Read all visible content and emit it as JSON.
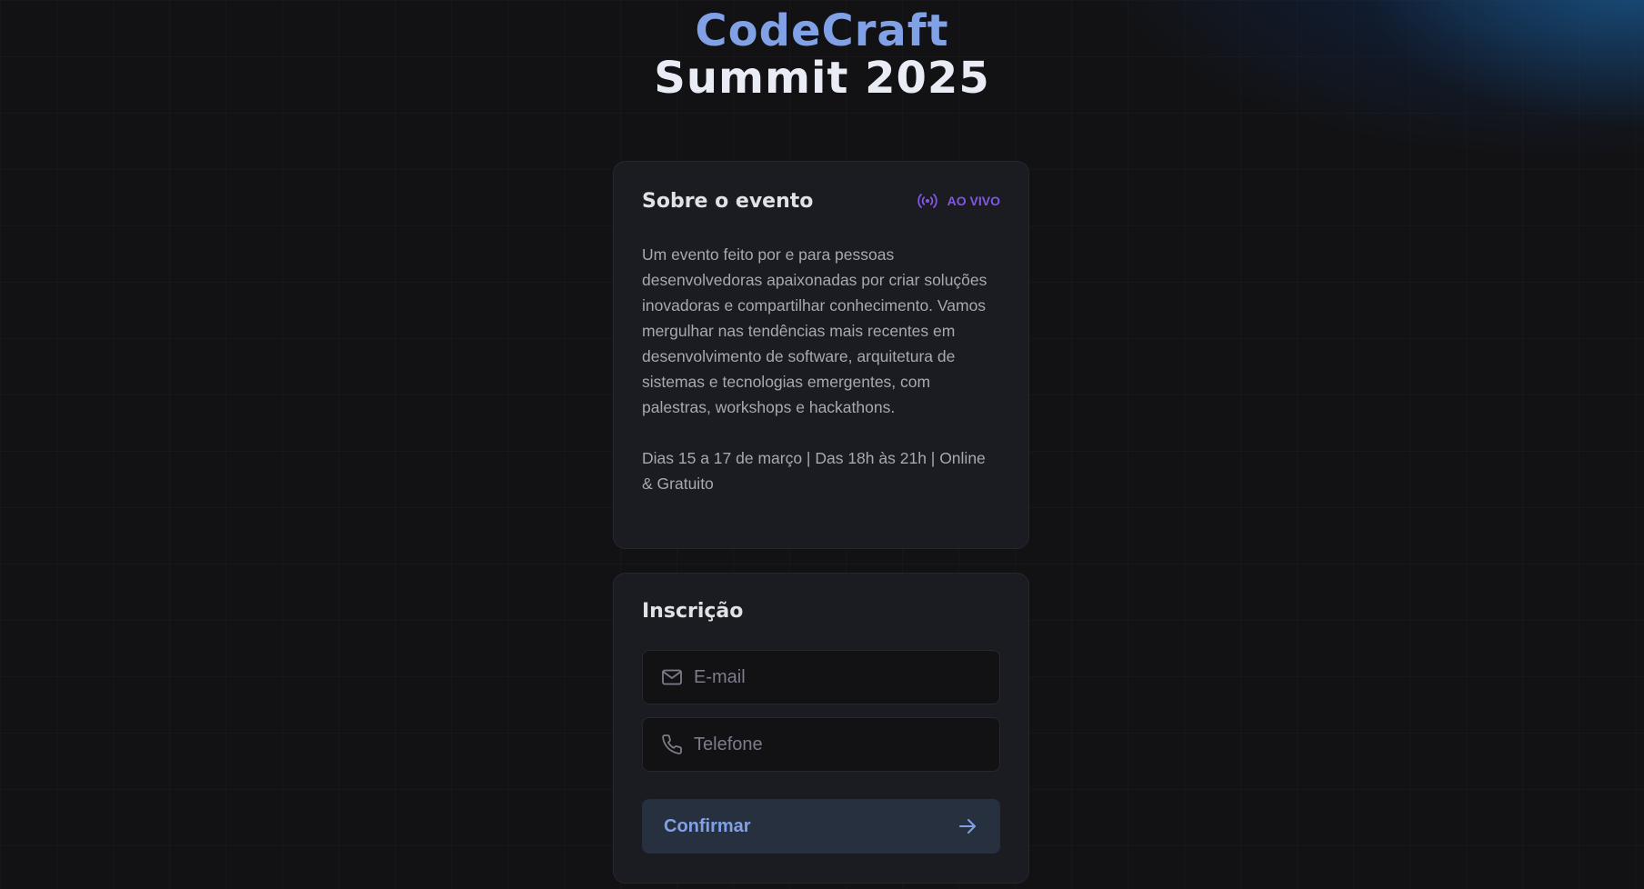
{
  "logo": {
    "line1": "CodeCraft",
    "line2": "Summit 2025"
  },
  "about": {
    "title": "Sobre o evento",
    "badge_icon": "radio-broadcast-icon",
    "badge_label": "AO VIVO",
    "description": "Um evento feito por e para pessoas desenvolvedoras apaixonadas por criar soluções inovadoras e compartilhar conhecimento. Vamos mergulhar nas tendências mais recentes em desenvolvimento de software, arquitetura de sistemas e tecnologias emergentes, com palestras, workshops e hackathons.",
    "schedule": "Dias 15 a 17 de março | Das 18h às 21h | Online & Gratuito"
  },
  "form": {
    "title": "Inscrição",
    "email": {
      "icon": "mail-icon",
      "placeholder": "E-mail",
      "value": ""
    },
    "phone": {
      "icon": "phone-icon",
      "placeholder": "Telefone",
      "value": ""
    },
    "submit": {
      "label": "Confirmar",
      "icon": "arrow-right-icon"
    }
  },
  "colors": {
    "background": "#121214",
    "card": "#1a1c22",
    "accent_blue": "#81a1e6",
    "accent_purple": "#8257e5",
    "text_muted": "#a8a8b3",
    "button_bg": "#26303f"
  }
}
